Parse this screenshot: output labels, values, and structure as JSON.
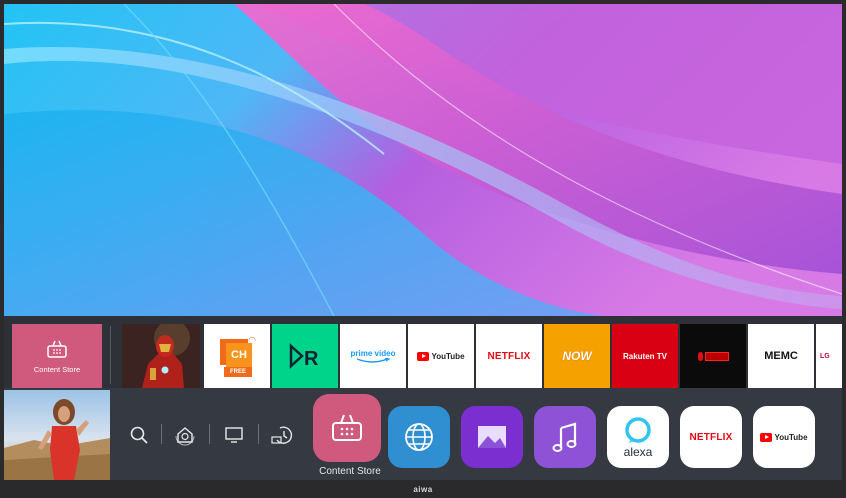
{
  "brand": {
    "name": "aiwa"
  },
  "recents": {
    "store_label": "Content Store",
    "tiles": [
      {
        "id": "ironman",
        "label": ""
      },
      {
        "id": "ch-free",
        "label": "CH",
        "badge": "FREE"
      },
      {
        "id": "rakuten-r",
        "label": "R"
      },
      {
        "id": "prime-video",
        "label": "prime video"
      },
      {
        "id": "youtube",
        "label": "YouTube"
      },
      {
        "id": "netflix",
        "label": "NETFLIX"
      },
      {
        "id": "now",
        "label": "NOW"
      },
      {
        "id": "rakuten-tv",
        "label": "Rakuten TV"
      },
      {
        "id": "red-app",
        "label": ""
      },
      {
        "id": "memc",
        "label": "MEMC"
      },
      {
        "id": "lg",
        "label": "LG"
      }
    ]
  },
  "launcher": {
    "nav": [
      {
        "id": "search",
        "icon": "search-icon"
      },
      {
        "id": "home",
        "icon": "home-icon"
      },
      {
        "id": "tv",
        "icon": "tv-icon"
      },
      {
        "id": "history",
        "icon": "history-icon"
      }
    ],
    "apps": [
      {
        "id": "content-store",
        "label": "Content Store",
        "color": "#cf5a7d",
        "selected": true
      },
      {
        "id": "browser",
        "color": "#2f8fd0"
      },
      {
        "id": "photos",
        "color": "#7b2fd0"
      },
      {
        "id": "music",
        "color": "#8d52d6"
      },
      {
        "id": "alexa",
        "label": "alexa",
        "color": "#ffffff"
      },
      {
        "id": "netflix",
        "label": "NETFLIX",
        "color": "#ffffff"
      },
      {
        "id": "youtube",
        "label": "YouTube",
        "color": "#ffffff"
      }
    ]
  },
  "colors": {
    "accent": "#cf5a7d",
    "netflix_red": "#e50914",
    "youtube_red": "#ff0000",
    "prime_blue": "#1a98ff",
    "now_orange": "#f5a100",
    "rakuten_red": "#bf0000"
  }
}
